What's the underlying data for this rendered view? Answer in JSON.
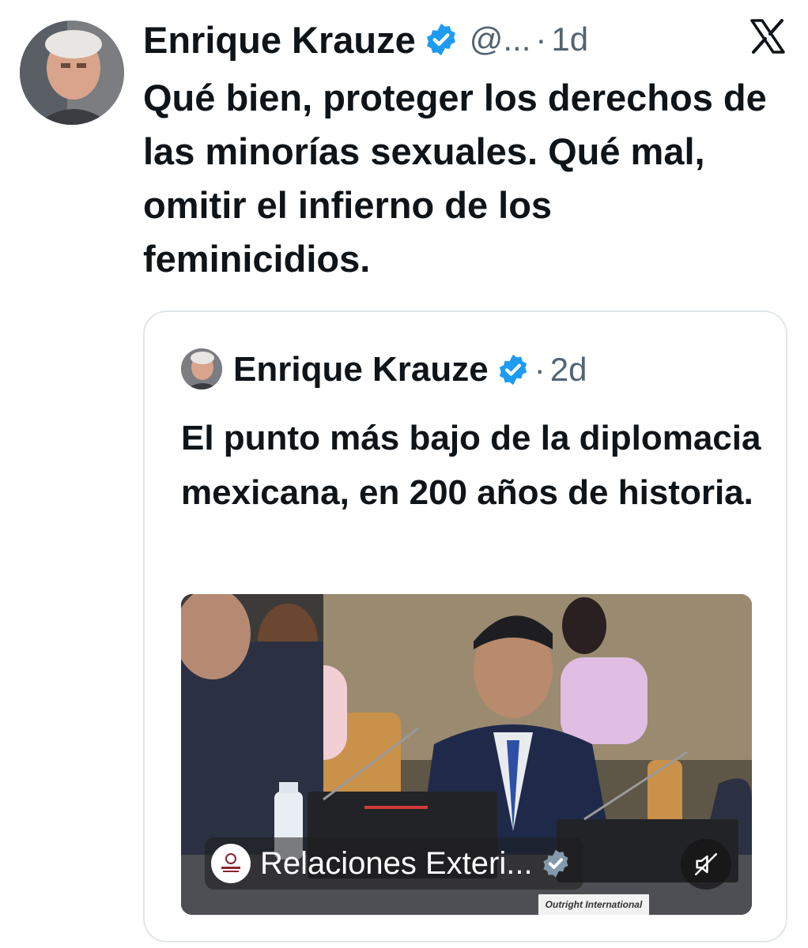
{
  "tweet": {
    "author_name": "Enrique Krauze",
    "handle": "@...",
    "separator": "·",
    "time": "1d",
    "text": "Qué bien, proteger los derechos de las minorías sexuales. Qué mal, omitir el infierno de los feminicidios.",
    "platform_icon": "x-logo-icon",
    "verified_color": "#1d9bf0"
  },
  "quoted_tweet": {
    "author_name": "Enrique Krauze",
    "separator": "·",
    "time": "2d",
    "text": "El punto más bajo de la diplomacia mexicana, en 200 años de historia.",
    "media": {
      "type": "video",
      "source_name": "Relaciones Exteri...",
      "logo_text": "Relaciones Exteriores",
      "nameplate_text": "Outright International",
      "muted": true,
      "mute_icon": "speaker-muted-icon"
    }
  }
}
